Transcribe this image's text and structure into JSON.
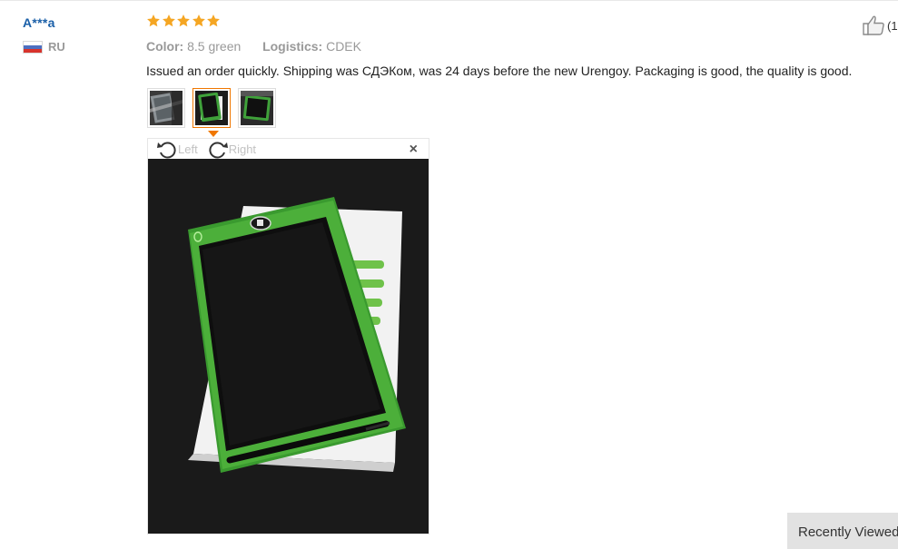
{
  "reviewer": {
    "name": "A***a",
    "country_code": "RU"
  },
  "rating": {
    "stars": 5,
    "max": 5,
    "color": "#f5a623"
  },
  "meta": {
    "color_label": "Color:",
    "color_value": "8.5 green",
    "logistics_label": "Logistics:",
    "logistics_value": "CDEK"
  },
  "review_text": "Issued an order quickly. Shipping was СДЭКом, was 24 days before the new Urengoy. Packaging is good, the quality is good.",
  "helpful": {
    "icon": "thumbs-up-icon",
    "count_text": "(1"
  },
  "thumbnails": [
    {
      "name": "review-photo-1",
      "active": false
    },
    {
      "name": "review-photo-2",
      "active": true
    },
    {
      "name": "review-photo-3",
      "active": false
    }
  ],
  "viewer": {
    "rotate_left_label": "Left",
    "rotate_right_label": "Right",
    "close_glyph": "×"
  },
  "footer": {
    "recently_viewed_label": "Recently Viewed"
  },
  "colors": {
    "accent": "#f07700",
    "link": "#1a5fa8",
    "tablet_green": "#4caf3a"
  }
}
